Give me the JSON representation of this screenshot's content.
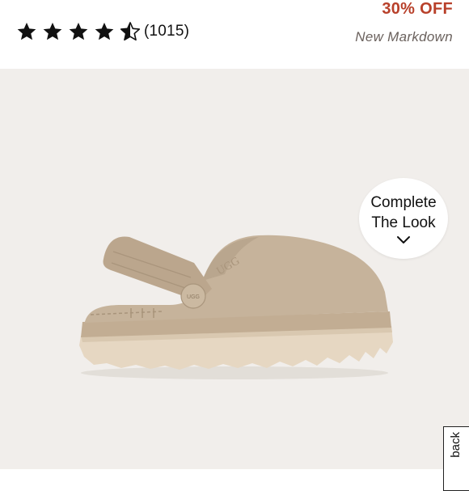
{
  "rating": {
    "value": 4.5,
    "max": 5,
    "count_label": "(1015)"
  },
  "price": {
    "discount_label": "30% OFF",
    "markdown_label": "New Markdown"
  },
  "complete_look": {
    "line1": "Complete",
    "line2": "The Look",
    "icon": "chevron-down-icon"
  },
  "feedback": {
    "label": "back"
  },
  "product": {
    "image_icon": "clog-shoe-image",
    "logo_text": "UGG",
    "strap_button_text": "UGG"
  },
  "colors": {
    "discount": "#b8402a",
    "markdown": "#6b625e",
    "product_background": "#f1eeeb",
    "shoe_upper": "#c6b39b",
    "shoe_sole": "#e6d7c2"
  }
}
